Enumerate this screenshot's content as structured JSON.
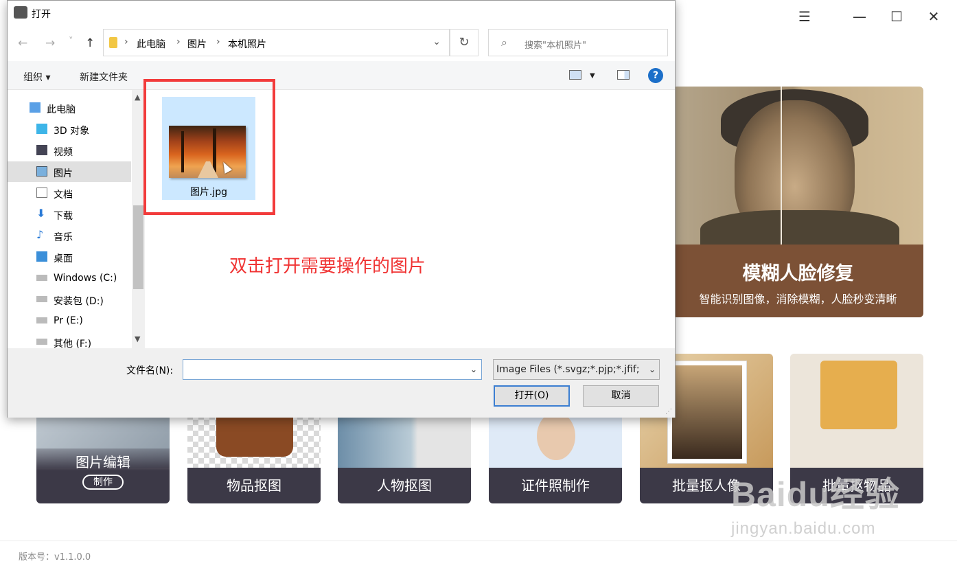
{
  "app": {
    "window_controls": {
      "menu": "☰",
      "minimize": "—",
      "maximize": "☐",
      "close": "✕"
    },
    "hero": {
      "title": "模糊人脸修复",
      "subtitle": "智能识别图像，消除模糊，人脸秒变清晰"
    },
    "tools": [
      {
        "label": "图片编辑",
        "button": "制作"
      },
      {
        "label": "物品抠图"
      },
      {
        "label": "人物抠图"
      },
      {
        "label": "证件照制作"
      },
      {
        "label": "批量抠人像"
      },
      {
        "label": "批量抠物品"
      }
    ],
    "version": "版本号：v1.1.0.0"
  },
  "watermark": {
    "main": "Baidu经验",
    "sub": "jingyan.baidu.com"
  },
  "dialog": {
    "title": "打开",
    "nav": {
      "back": "←",
      "forward": "→",
      "recent": "˅",
      "up": "↑"
    },
    "breadcrumb": [
      "此电脑",
      "图片",
      "本机照片"
    ],
    "refresh_icon": "↻",
    "search_placeholder": "搜索\"本机照片\"",
    "toolbar": {
      "organize": "组织 ▾",
      "new_folder": "新建文件夹",
      "help": "?"
    },
    "tree": [
      {
        "label": "此电脑",
        "icon": "computer-icon"
      },
      {
        "label": "3D 对象",
        "icon": "cube-icon"
      },
      {
        "label": "视频",
        "icon": "video-icon"
      },
      {
        "label": "图片",
        "icon": "pictures-icon",
        "selected": true
      },
      {
        "label": "文档",
        "icon": "document-icon"
      },
      {
        "label": "下载",
        "icon": "download-icon"
      },
      {
        "label": "音乐",
        "icon": "music-icon"
      },
      {
        "label": "桌面",
        "icon": "desktop-icon"
      },
      {
        "label": "Windows (C:)",
        "icon": "drive-icon"
      },
      {
        "label": "安装包 (D:)",
        "icon": "drive-icon"
      },
      {
        "label": "Pr (E:)",
        "icon": "drive-icon"
      },
      {
        "label": "其他 (F:)",
        "icon": "drive-icon"
      }
    ],
    "files": [
      {
        "name": "图片.jpg"
      }
    ],
    "annotation": "双击打开需要操作的图片",
    "filename_label": "文件名(N):",
    "filename_value": "",
    "filetype": "Image Files (*.svgz;*.pjp;*.jfif;",
    "open_button": "打开(O)",
    "cancel_button": "取消"
  }
}
